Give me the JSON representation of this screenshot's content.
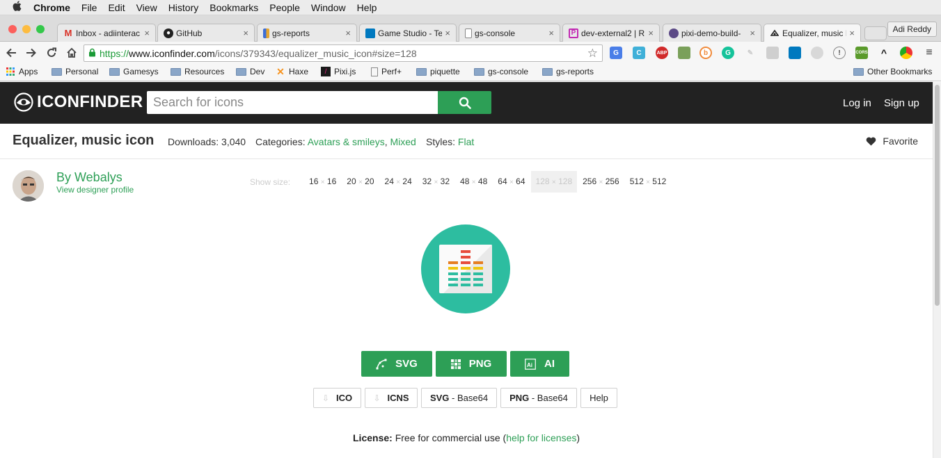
{
  "menubar": {
    "items": [
      "Chrome",
      "File",
      "Edit",
      "View",
      "History",
      "Bookmarks",
      "People",
      "Window",
      "Help"
    ]
  },
  "tabs": [
    {
      "title": "Inbox - adiinterac",
      "icon": "gmail-icon"
    },
    {
      "title": "GitHub",
      "icon": "github-icon"
    },
    {
      "title": "gs-reports",
      "icon": "gs-reports-icon"
    },
    {
      "title": "Game Studio - Te",
      "icon": "trello-icon"
    },
    {
      "title": "gs-console",
      "icon": "page-icon"
    },
    {
      "title": "dev-external2 | R",
      "icon": "p-icon"
    },
    {
      "title": "pixi-demo-build-",
      "icon": "pixi-icon"
    },
    {
      "title": "Equalizer, music I",
      "icon": "iconfinder-icon"
    }
  ],
  "profile_name": "Adi Reddy",
  "address": {
    "scheme": "https://",
    "host": "www.iconfinder.com",
    "path": "/icons/379343/equalizer_music_icon#size=128"
  },
  "bookmarks": [
    {
      "label": "Apps",
      "icon": "apps-icon"
    },
    {
      "label": "Personal",
      "icon": "folder-icon"
    },
    {
      "label": "Gamesys",
      "icon": "folder-icon"
    },
    {
      "label": "Resources",
      "icon": "folder-icon"
    },
    {
      "label": "Dev",
      "icon": "folder-icon"
    },
    {
      "label": "Haxe",
      "icon": "haxe-icon"
    },
    {
      "label": "Pixi.js",
      "icon": "pixi-icon"
    },
    {
      "label": "Perf+",
      "icon": "page-icon"
    },
    {
      "label": "piquette",
      "icon": "folder-icon"
    },
    {
      "label": "gs-console",
      "icon": "folder-icon"
    },
    {
      "label": "gs-reports",
      "icon": "folder-icon"
    }
  ],
  "other_bookmarks": "Other Bookmarks",
  "site": {
    "logo": "ICONFINDER",
    "search_placeholder": "Search for icons",
    "login": "Log in",
    "signup": "Sign up"
  },
  "icon_page": {
    "title": "Equalizer, music icon",
    "downloads_label": "Downloads:",
    "downloads": "3,040",
    "categories_label": "Categories:",
    "categories": [
      "Avatars & smileys",
      "Mixed"
    ],
    "styles_label": "Styles:",
    "style": "Flat",
    "favorite": "Favorite",
    "designer_by": "By Webalys",
    "designer_link": "View designer profile",
    "show_size_label": "Show size:",
    "sizes": [
      {
        "w": "16",
        "h": "16"
      },
      {
        "w": "20",
        "h": "20"
      },
      {
        "w": "24",
        "h": "24"
      },
      {
        "w": "32",
        "h": "32"
      },
      {
        "w": "48",
        "h": "48"
      },
      {
        "w": "64",
        "h": "64"
      },
      {
        "w": "128",
        "h": "128"
      },
      {
        "w": "256",
        "h": "256"
      },
      {
        "w": "512",
        "h": "512"
      }
    ],
    "times": "×",
    "selected_size": "128",
    "downloads_primary": [
      "SVG",
      "PNG",
      "AI"
    ],
    "downloads_alt": {
      "ico": "ICO",
      "icns": "ICNS",
      "svg_b64_main": "SVG",
      "svg_b64_rest": " - Base64",
      "png_b64_main": "PNG",
      "png_b64_rest": " - Base64",
      "help": "Help"
    },
    "license_label": "License:",
    "license_text": " Free for commercial use (",
    "license_link": "help for licenses",
    "license_close": ")"
  },
  "colors": {
    "accent": "#2d9f56",
    "header_bg": "#222222",
    "icon_teal": "#2dbda0"
  }
}
